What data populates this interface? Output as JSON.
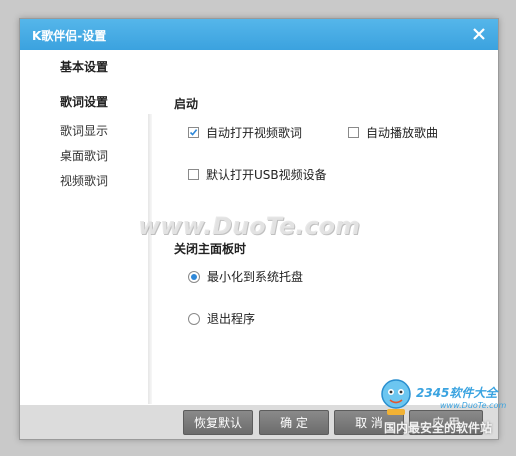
{
  "window": {
    "title": "K歌伴侣-设置"
  },
  "sidebar": {
    "basic": "基本设置",
    "lyrics_group": "歌词设置",
    "items": [
      "歌词显示",
      "桌面歌词",
      "视频歌词"
    ]
  },
  "startup": {
    "section": "启动",
    "options": [
      {
        "label": "自动打开视频歌词",
        "checked": true
      },
      {
        "label": "自动播放歌曲",
        "checked": false
      },
      {
        "label": "默认打开USB视频设备",
        "checked": false
      }
    ]
  },
  "close_panel": {
    "section": "关闭主面板时",
    "options": [
      {
        "label": "最小化到系统托盘",
        "selected": true
      },
      {
        "label": "退出程序",
        "selected": false
      }
    ]
  },
  "footer": {
    "restore": "恢复默认",
    "ok": "确 定",
    "cancel": "取 消",
    "apply": "应 用"
  },
  "watermarks": {
    "duote": "www.DuoTe.com",
    "site": "2345软件大全",
    "slogan": "国内最安全的软件站",
    "small": "www.DuoTe.com"
  },
  "colors": {
    "titlebar": "#3ba2df",
    "check": "#2f88d8"
  }
}
